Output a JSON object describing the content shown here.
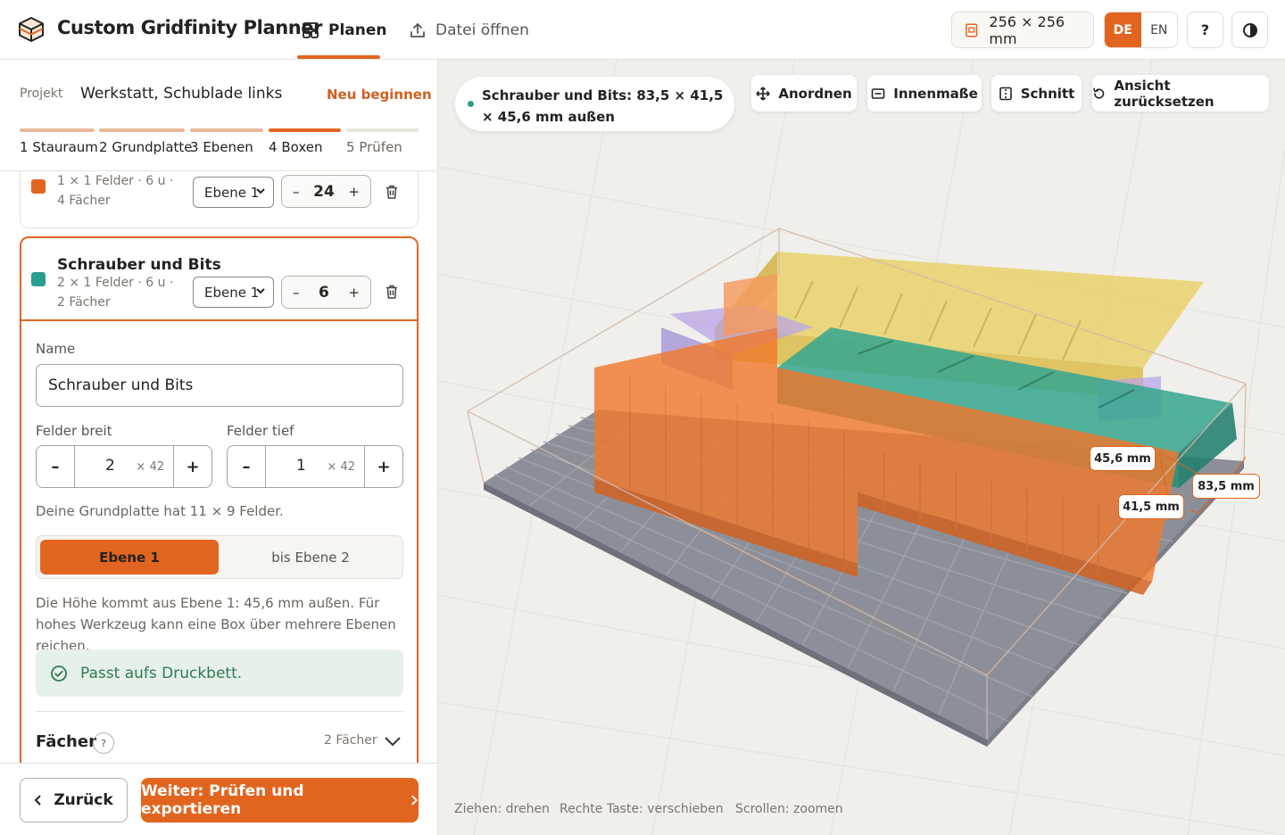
{
  "app": {
    "title": "Custom Gridfinity Planner"
  },
  "nav": {
    "plan": "Planen",
    "open": "Datei öffnen"
  },
  "toolbar": {
    "size": "256 × 256 mm",
    "lang_de": "DE",
    "lang_en": "EN",
    "help": "?"
  },
  "project": {
    "label": "Projekt",
    "name": "Werkstatt, Schublade links",
    "restart": "Neu beginnen"
  },
  "steps": [
    {
      "num": "1",
      "label": "Stauraum"
    },
    {
      "num": "2",
      "label": "Grundplatte"
    },
    {
      "num": "3",
      "label": "Ebenen"
    },
    {
      "num": "4",
      "label": "Boxen"
    },
    {
      "num": "5",
      "label": "Prüfen"
    }
  ],
  "boxes": [
    {
      "meta": "1 × 1 Felder · 6 u · 4 Fächer",
      "level": "Ebene 1",
      "count": "24",
      "color": "#e2651f"
    },
    {
      "title": "Schrauber und Bits",
      "meta": "2 × 1 Felder · 6 u · 2 Fächer",
      "level": "Ebene 1",
      "count": "6",
      "color": "#2a9d8f"
    }
  ],
  "editor": {
    "name_label": "Name",
    "name_value": "Schrauber und Bits",
    "width_label": "Felder breit",
    "depth_label": "Felder tief",
    "width_value": "2",
    "depth_value": "1",
    "unit": "× 42",
    "minus": "–",
    "plus": "+",
    "grid_hint": "Deine Grundplatte hat 11 × 9 Felder.",
    "seg_on": "Ebene 1",
    "seg_off": "bis Ebene 2",
    "height_desc": "Die Höhe kommt aus Ebene 1: 45,6 mm außen. Für hohes Werkzeug kann eine Box über mehrere Ebenen reichen.",
    "ok": "Passt aufs Druckbett.",
    "faecher": "Fächer",
    "faecher_help": "?",
    "faecher_count": "2 Fächer"
  },
  "footer": {
    "back": "Zurück",
    "next": "Weiter: Prüfen und exportieren"
  },
  "viewport": {
    "selection": "Schrauber und Bits: 83,5 × 41,5 × 45,6 mm außen",
    "arrange": "Anordnen",
    "inner": "Innenmaße",
    "cut": "Schnitt",
    "reset": "Ansicht zurücksetzen",
    "dim_height": "45,6 mm",
    "dim_width": "83,5 mm",
    "dim_depth": "41,5 mm",
    "help_rotate": "Ziehen: drehen",
    "help_pan": "Rechte Taste: verschieben",
    "help_zoom": "Scrollen: zoomen"
  },
  "colors": {
    "accent": "#e2651f",
    "teal": "#2a9d8f",
    "yellow": "#e3c243",
    "purple": "#a98ad6",
    "baseplate": "#8d8f98"
  }
}
